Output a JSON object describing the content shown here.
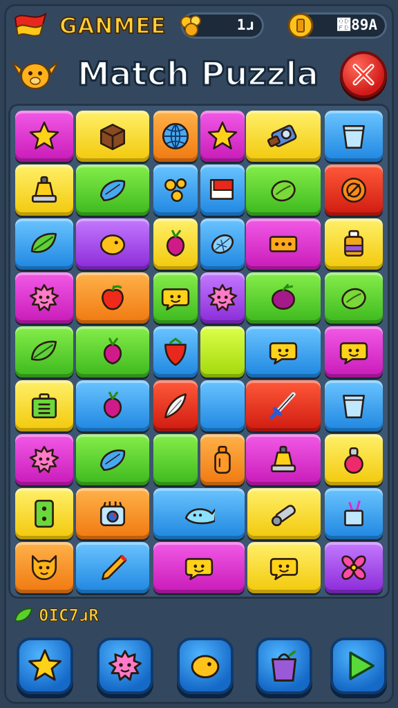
{
  "header": {
    "brand": "GANMEE",
    "gems_value": "1ɹ",
    "coins_value": "෽89A"
  },
  "title": "Match Puzzla",
  "footer": {
    "score": "0IC7ɹR"
  },
  "colors": {
    "magenta": "#e02ad0",
    "yellow": "#ffe01a",
    "blue": "#2f9ff0",
    "green": "#4fd12a",
    "orange": "#ff8a18",
    "red": "#e5281a",
    "purple": "#a43ef0",
    "lime": "#b9ee1a"
  },
  "board": {
    "rows": 9,
    "tiles": [
      {
        "color": "magenta",
        "icon": "star-icon"
      },
      {
        "color": "yellow",
        "icon": "box-icon"
      },
      {
        "color": "orange",
        "icon": "globe-icon"
      },
      {
        "color": "magenta",
        "icon": "star-icon"
      },
      {
        "color": "yellow",
        "icon": "camera-icon"
      },
      {
        "color": "blue",
        "icon": "cup-icon"
      },
      {
        "color": "yellow",
        "icon": "bell-icon"
      },
      {
        "color": "green",
        "icon": "fish-icon"
      },
      {
        "color": "blue",
        "icon": "coins-icon"
      },
      {
        "color": "blue",
        "icon": "flag-icon"
      },
      {
        "color": "green",
        "icon": "lime-icon"
      },
      {
        "color": "red",
        "icon": "target-icon"
      },
      {
        "color": "blue",
        "icon": "leaf-icon"
      },
      {
        "color": "purple",
        "icon": "lemon-icon"
      },
      {
        "color": "yellow",
        "icon": "beet-icon"
      },
      {
        "color": "blue",
        "icon": "shell-icon"
      },
      {
        "color": "magenta",
        "icon": "panel-icon"
      },
      {
        "color": "yellow",
        "icon": "jar-icon"
      },
      {
        "color": "magenta",
        "icon": "spiky-face-icon"
      },
      {
        "color": "orange",
        "icon": "apple-icon"
      },
      {
        "color": "green",
        "icon": "chat-face-icon"
      },
      {
        "color": "purple",
        "icon": "spiky-face-icon"
      },
      {
        "color": "green",
        "icon": "plum-icon"
      },
      {
        "color": "green",
        "icon": "lime-icon"
      },
      {
        "color": "green",
        "icon": "leaf-icon"
      },
      {
        "color": "green",
        "icon": "beet-icon"
      },
      {
        "color": "blue",
        "icon": "strawberry-icon"
      },
      {
        "color": "lime",
        "icon": "blank"
      },
      {
        "color": "blue",
        "icon": "chat-face-icon"
      },
      {
        "color": "magenta",
        "icon": "chat-face-icon"
      },
      {
        "color": "yellow",
        "icon": "suitcase-icon"
      },
      {
        "color": "blue",
        "icon": "beet-icon"
      },
      {
        "color": "red",
        "icon": "feather-icon"
      },
      {
        "color": "blue",
        "icon": "blank"
      },
      {
        "color": "red",
        "icon": "sword-icon"
      },
      {
        "color": "blue",
        "icon": "cup-icon"
      },
      {
        "color": "magenta",
        "icon": "spiky-face-icon"
      },
      {
        "color": "green",
        "icon": "fish-icon"
      },
      {
        "color": "green",
        "icon": "blank"
      },
      {
        "color": "orange",
        "icon": "bottle-icon"
      },
      {
        "color": "magenta",
        "icon": "bell-icon"
      },
      {
        "color": "yellow",
        "icon": "potion-icon"
      },
      {
        "color": "yellow",
        "icon": "domino-icon"
      },
      {
        "color": "orange",
        "icon": "robot-icon"
      },
      {
        "color": "blue",
        "icon": "whale-icon"
      },
      {
        "color": "yellow",
        "icon": "flashlight-icon"
      },
      {
        "color": "blue",
        "icon": "pencil-cup-icon"
      },
      {
        "color": "orange",
        "icon": "cat-face-icon"
      },
      {
        "color": "blue",
        "icon": "pencil-icon"
      },
      {
        "color": "magenta",
        "icon": "chat-face-icon"
      },
      {
        "color": "yellow",
        "icon": "chat-face-icon"
      },
      {
        "color": "purple",
        "icon": "propeller-icon"
      }
    ]
  },
  "bottom_buttons": [
    {
      "name": "star-button",
      "icon": "star-icon"
    },
    {
      "name": "face-button",
      "icon": "spiky-face-icon"
    },
    {
      "name": "lemon-button",
      "icon": "lemon-icon"
    },
    {
      "name": "bag-button",
      "icon": "bag-icon"
    },
    {
      "name": "play-button",
      "icon": "play-icon"
    }
  ]
}
